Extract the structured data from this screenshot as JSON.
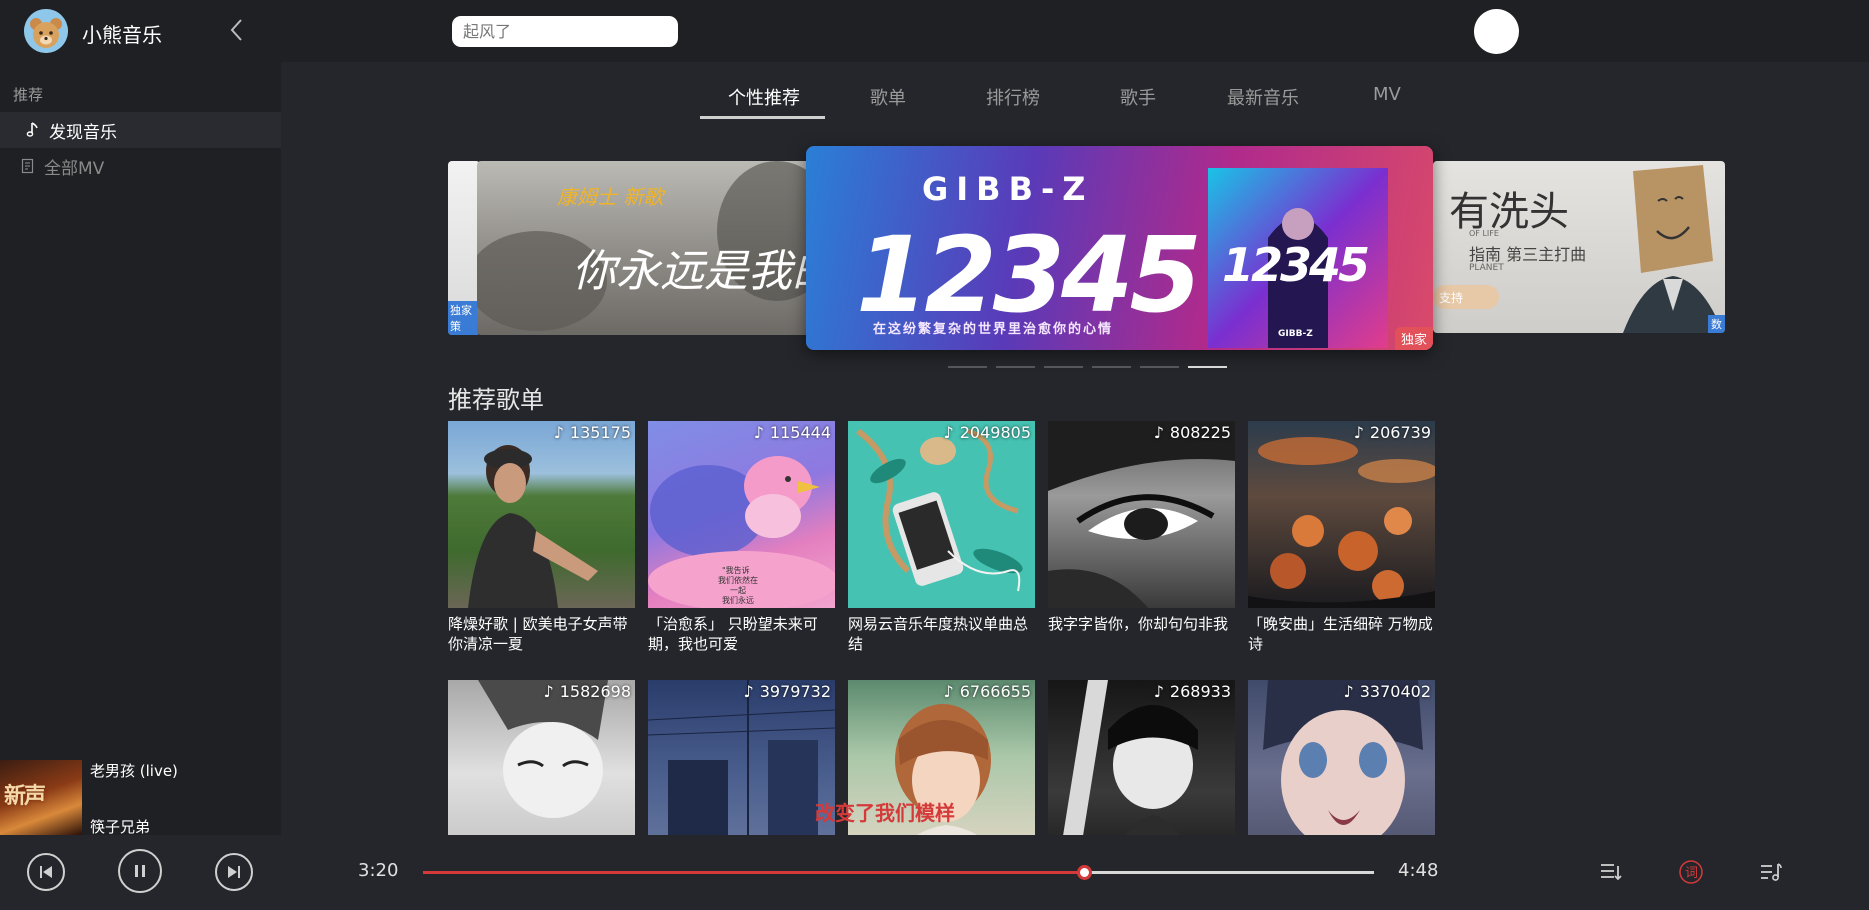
{
  "app": {
    "name": "小熊音乐"
  },
  "search": {
    "placeholder": "起风了"
  },
  "sidebar": {
    "section": "推荐",
    "items": [
      {
        "label": "发现音乐",
        "icon": "music-note-icon",
        "active": true
      },
      {
        "label": "全部MV",
        "icon": "document-icon",
        "active": false
      }
    ]
  },
  "tabs": [
    "个性推荐",
    "歌单",
    "排行榜",
    "歌手",
    "最新音乐",
    "MV"
  ],
  "carousel": {
    "left_tag": "独家策",
    "center": {
      "title": "GIBB-Z",
      "big": "12345",
      "caption": "在这纷繁复杂的世界里治愈你的心情",
      "cover_big": "12345",
      "cover_small": "GIBB-Z",
      "tag": "独家"
    },
    "left_text_top": "康姆士   新歌",
    "left_text": "你永远是我的",
    "right_text": "有洗头",
    "right_sub": "指南 第三主打曲",
    "right_small": "OF LIFE",
    "right_small2": "PLANET",
    "right_btn": "支持",
    "right_tag": "数",
    "dots": 6,
    "active_dot": 5
  },
  "playlists": {
    "title": "推荐歌单",
    "items": [
      {
        "count": "135175",
        "title": "降燥好歌 | 欧美电子女声带你清凉一夏"
      },
      {
        "count": "115444",
        "title": "「治愈系」 只盼望未来可期，我也可爱"
      },
      {
        "count": "2049805",
        "title": "网易云音乐年度热议单曲总结"
      },
      {
        "count": "808225",
        "title": "我字字皆你，你却句句非我"
      },
      {
        "count": "206739",
        "title": "「晚安曲」生活细碎 万物成诗"
      },
      {
        "count": "1582698",
        "title": ""
      },
      {
        "count": "3979732",
        "title": ""
      },
      {
        "count": "6766655",
        "title": ""
      },
      {
        "count": "268933",
        "title": ""
      },
      {
        "count": "3370402",
        "title": ""
      }
    ]
  },
  "lyric": "改变了我们模样",
  "now_playing": {
    "title": "老男孩 (live)",
    "artist": "筷子兄弟",
    "cover_text": "新声"
  },
  "player": {
    "current": "3:20",
    "total": "4:48",
    "progress": 0.6954
  },
  "colors": {
    "accent": "#d53a3a",
    "background": "#1f2024",
    "main": "#25262b"
  }
}
